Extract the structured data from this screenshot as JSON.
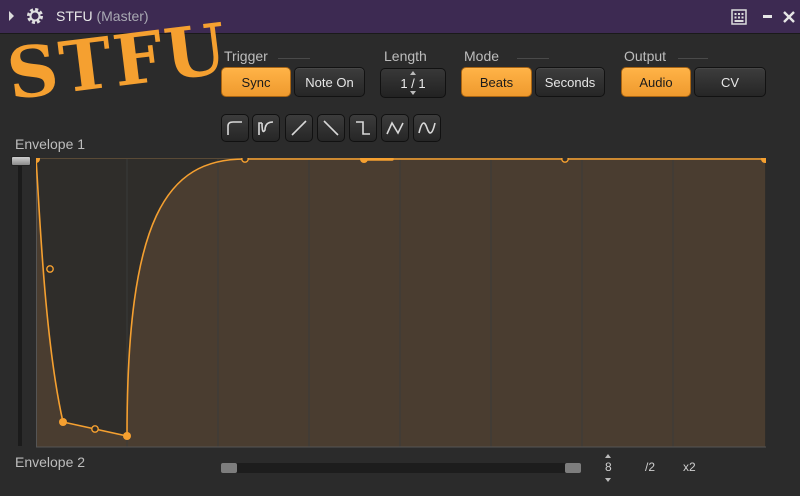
{
  "window": {
    "title": "STFU",
    "subtitle": "(Master)"
  },
  "logo": "STFU",
  "trigger": {
    "label": "Trigger",
    "sync": "Sync",
    "note_on": "Note On",
    "active": "sync"
  },
  "length": {
    "label": "Length",
    "value": "1 / 1"
  },
  "mode": {
    "label": "Mode",
    "beats": "Beats",
    "seconds": "Seconds",
    "active": "beats"
  },
  "output": {
    "label": "Output",
    "audio": "Audio",
    "cv": "CV",
    "active": "audio"
  },
  "shapes": [
    "attack-shape-icon",
    "soft-attack-shape-icon",
    "ramp-up-icon",
    "ramp-down-icon",
    "step-down-icon",
    "triangle-icon",
    "sine-icon"
  ],
  "envelope1": {
    "label": "Envelope 1",
    "grid_divisions": 8
  },
  "envelope2": {
    "label": "Envelope 2"
  },
  "zoom": {
    "value": "8",
    "div": "/2",
    "mul": "x2"
  },
  "colors": {
    "accent": "#f5a030",
    "title_bar": "#3d2a52",
    "envelope_fill": "#4a3d30"
  }
}
